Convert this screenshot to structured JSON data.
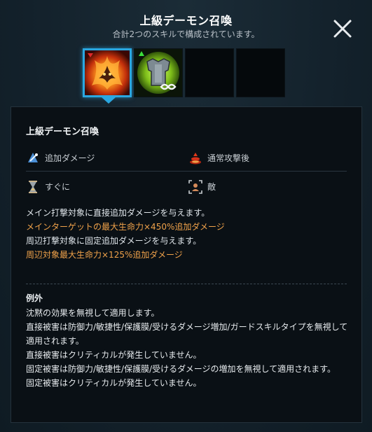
{
  "header": {
    "title": "上級デーモン召喚",
    "subtitle": "合計2つのスキルで構成されています。"
  },
  "skills": [
    {
      "name": "demon-fire-skill",
      "selected": true
    },
    {
      "name": "armor-infinity-skill",
      "selected": false
    },
    {
      "name": "empty-slot",
      "selected": false
    },
    {
      "name": "empty-slot",
      "selected": false
    }
  ],
  "panel": {
    "skill_name": "上級デーモン召喚",
    "attributes": {
      "damage_type": "追加ダメージ",
      "trigger": "通常攻撃後",
      "timing": "すぐに",
      "target": "敵"
    },
    "description": [
      {
        "text": "メイン打撃対象に直接追加ダメージを与えます。",
        "color": "white"
      },
      {
        "text": "メインターゲットの最大生命力×450%追加ダメージ",
        "color": "orange"
      },
      {
        "text": "周辺打撃対象に固定追加ダメージを与えます。",
        "color": "white"
      },
      {
        "text": "周辺対象最大生命力×125%追加ダメージ",
        "color": "orange"
      }
    ],
    "exceptions_title": "例外",
    "exceptions": [
      "沈黙の効果を無視して適用します。",
      "直接被害は防御力/敏捷性/保護膜/受けるダメージ増加/ガードスキルタイプを無視して適用されます。",
      "直接被害はクリティカルが発生していません。",
      "固定被害は防御力/敏捷性/保護膜/受けるダメージの増加を無視して適用されます。",
      "固定被害はクリティカルが発生していません。"
    ]
  },
  "colors": {
    "accent": "#2aa7e0",
    "highlight": "#f0a24a"
  }
}
